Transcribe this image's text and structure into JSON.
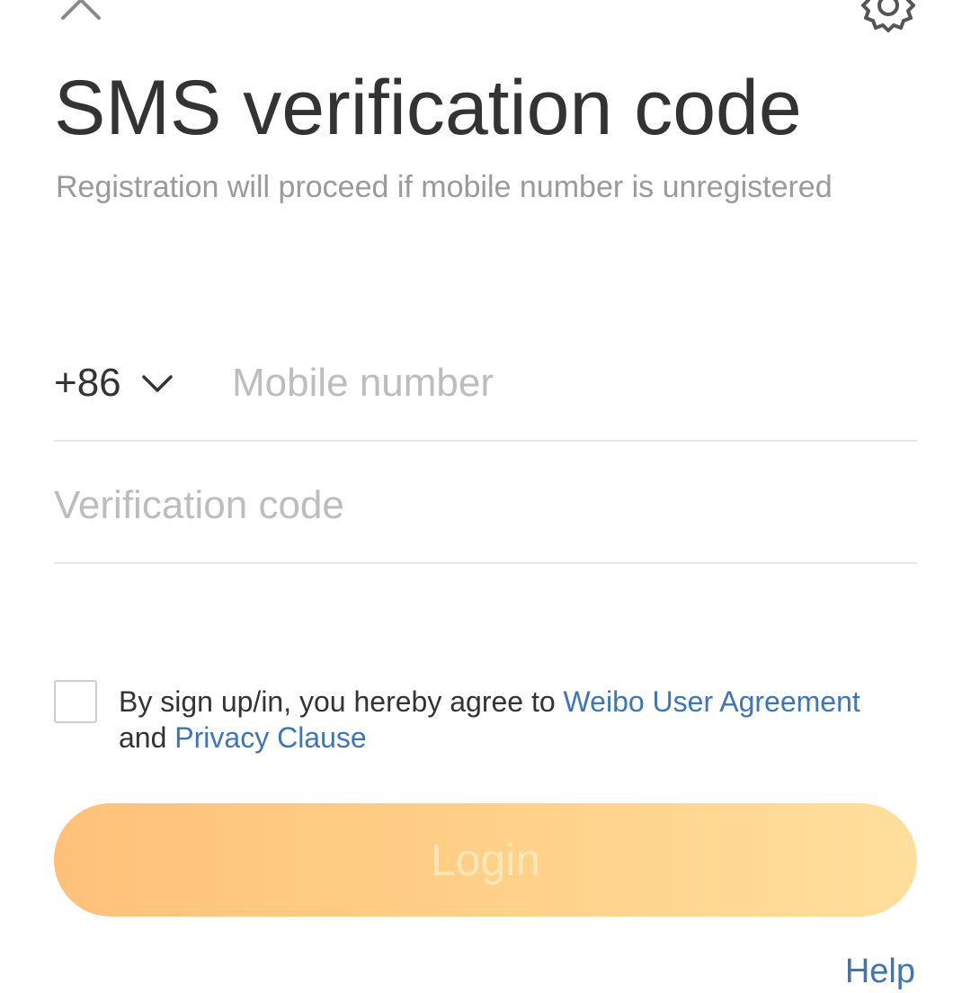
{
  "header": {
    "close_icon": "close-icon",
    "settings_icon": "gear-icon"
  },
  "page": {
    "title": "SMS verification code",
    "subtitle": "Registration will proceed if mobile number is unregistered"
  },
  "form": {
    "country_code": "+86",
    "phone_placeholder": "Mobile number",
    "phone_value": "",
    "code_placeholder": "Verification code",
    "code_value": ""
  },
  "agreement": {
    "checked": false,
    "prefix": "By sign up/in, you hereby agree to ",
    "user_agreement_link": "Weibo User Agreement",
    "and": " and ",
    "privacy_link": "Privacy Clause"
  },
  "actions": {
    "login_label": "Login",
    "help_label": "Help"
  },
  "colors": {
    "link": "#3d75b5",
    "button_gradient_start": "#ffc17a",
    "button_gradient_end": "#ffdf9c",
    "placeholder": "#bdbdbd"
  }
}
